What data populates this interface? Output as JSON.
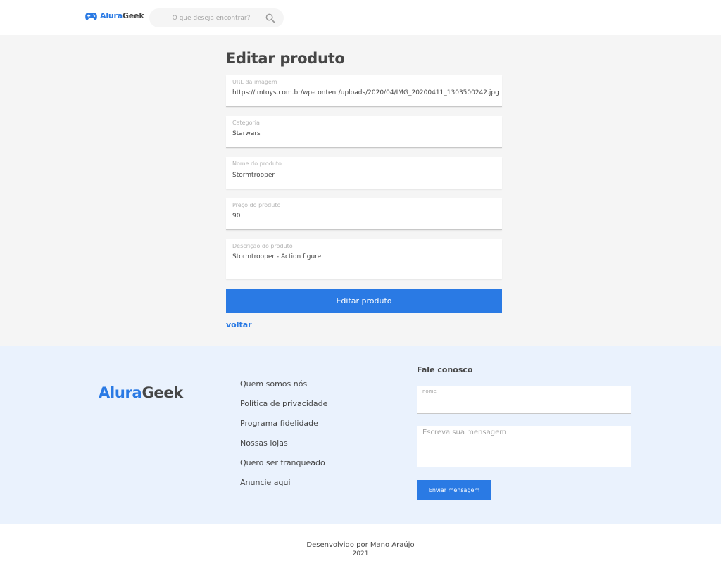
{
  "header": {
    "logo_first": "Alura",
    "logo_second": "Geek",
    "logo_icon": "gamepad-icon",
    "search_placeholder": "O que deseja encontrar?",
    "search_icon": "search-icon"
  },
  "main": {
    "title": "Editar produto",
    "fields": [
      {
        "label": "URL da imagem",
        "value": "https://imtoys.com.br/wp-content/uploads/2020/04/IMG_20200411_1303500242.jpg"
      },
      {
        "label": "Categoria",
        "value": "Starwars"
      },
      {
        "label": "Nome do produto",
        "value": "Stormtrooper"
      },
      {
        "label": "Preço do produto",
        "value": "90"
      },
      {
        "label": "Descrição do produto",
        "value": "Stormtrooper - Action figure"
      }
    ],
    "submit_label": "Editar produto",
    "back_label": "voltar"
  },
  "footer": {
    "logo_first": "Alura",
    "logo_second": "Geek",
    "links": [
      "Quem somos nós",
      "Política de privacidade",
      "Programa fidelidade",
      "Nossas lojas",
      "Quero ser franqueado",
      "Anuncie aqui"
    ],
    "contact_title": "Fale conosco",
    "name_label": "nome",
    "message_placeholder": "Escreva sua mensagem",
    "send_label": "Enviar mensagem"
  },
  "bottom": {
    "credits": "Desenvolvido por Mano Araújo",
    "year": "2021"
  },
  "colors": {
    "accent": "#2a7ae4",
    "text": "#464646",
    "main_bg": "#f5f5f5",
    "footer_bg": "#eaf2fd"
  }
}
